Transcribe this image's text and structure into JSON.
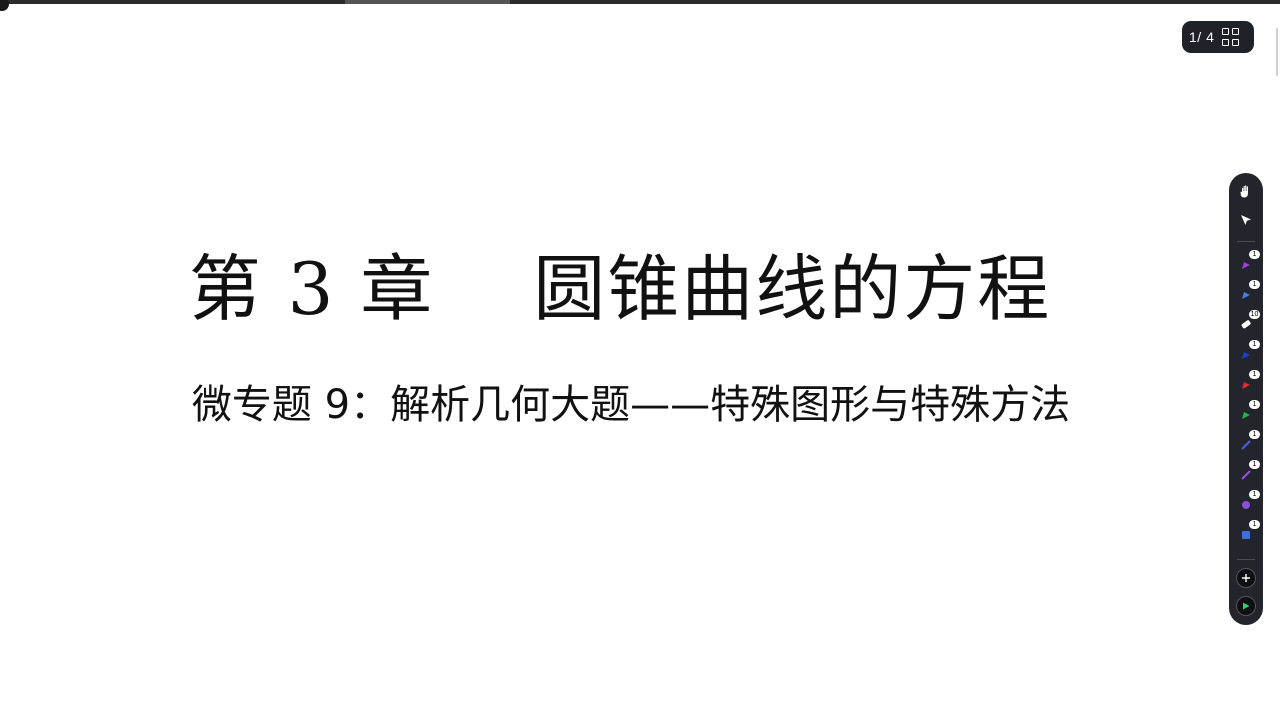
{
  "slide": {
    "title": "第 3 章　 圆锥曲线的方程",
    "subtitle": "微专题 9：解析几何大题——特殊图形与特殊方法"
  },
  "pager": {
    "counter": "1/ 4",
    "grid_icon": "grid-view-icon"
  },
  "toolbar": {
    "tools": [
      {
        "icon": "hand-pan-icon"
      },
      {
        "icon": "pointer-select-icon"
      },
      {
        "icon": "pen-purple-icon",
        "color": "#9b3fe0",
        "badge": "1"
      },
      {
        "icon": "pen-blue-icon",
        "color": "#3f7fe6",
        "badge": "1"
      },
      {
        "icon": "eraser-icon",
        "color": "#ffffff",
        "badge": "10"
      },
      {
        "icon": "pen-darkblue-icon",
        "color": "#1c3fd6",
        "badge": "1"
      },
      {
        "icon": "pen-red-icon",
        "color": "#e32b2b",
        "badge": "1"
      },
      {
        "icon": "pen-green-icon",
        "color": "#22b34a",
        "badge": "1"
      },
      {
        "icon": "line-blue-icon",
        "color": "#4d5cf0",
        "badge": "1"
      },
      {
        "icon": "line-purple-icon",
        "color": "#9c4df0",
        "badge": "1"
      },
      {
        "icon": "circle-shape-icon",
        "color": "#8a4fd8",
        "badge": "1"
      },
      {
        "icon": "square-shape-icon",
        "color": "#3b6fe0",
        "badge": "1"
      }
    ],
    "add_icon": "plus-icon",
    "play_icon": "play-icon"
  },
  "colors": {
    "toolbar_bg": "#22262c",
    "pager_bg": "#1f2329",
    "text": "#111111"
  }
}
